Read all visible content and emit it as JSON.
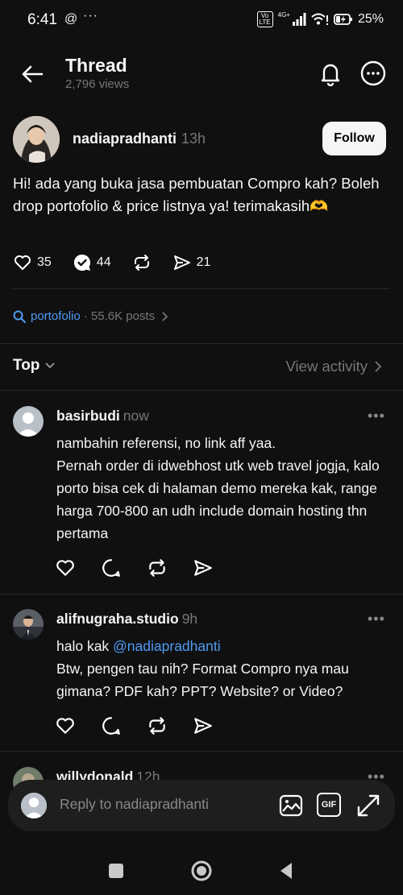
{
  "status": {
    "time": "6:41",
    "threads_glyph": "@",
    "dots": "···",
    "volte": "Vo\nLTE",
    "network": "4G+",
    "battery": "25%"
  },
  "header": {
    "title": "Thread",
    "views": "2,796 views"
  },
  "post": {
    "username": "nadiapradhanti",
    "time": "13h",
    "follow_label": "Follow",
    "text": "Hi! ada yang buka jasa pembuatan Compro kah? Boleh drop portofolio & price listnya ya! terimakasih🫶",
    "likes": "35",
    "replies": "44",
    "shares": "21"
  },
  "topic": {
    "name": "portofolio",
    "meta": "· 55.6K posts"
  },
  "sort": {
    "label": "Top",
    "view_activity": "View activity"
  },
  "replies": [
    {
      "username": "basirbudi",
      "time": "now",
      "text": "nambahin referensi, no link aff yaa.\nPernah order di idwebhost utk web travel jogja, kalo porto bisa cek di halaman demo mereka kak, range harga 700-800 an udh include domain hosting thn pertama"
    },
    {
      "username": "alifnugraha.studio",
      "time": "9h",
      "text_prefix": "halo kak ",
      "mention": "@nadiapradhanti",
      "text_rest": "Btw, pengen tau nih? Format Compro nya mau gimana? PDF kah? PPT? Website? or Video?"
    },
    {
      "username": "willydonald",
      "time": "12h"
    }
  ],
  "composer": {
    "placeholder": "Reply to nadiapradhanti",
    "gif_label": "GIF"
  },
  "colors": {
    "background": "#101010",
    "link": "#4f9bf5",
    "muted": "#777777"
  }
}
